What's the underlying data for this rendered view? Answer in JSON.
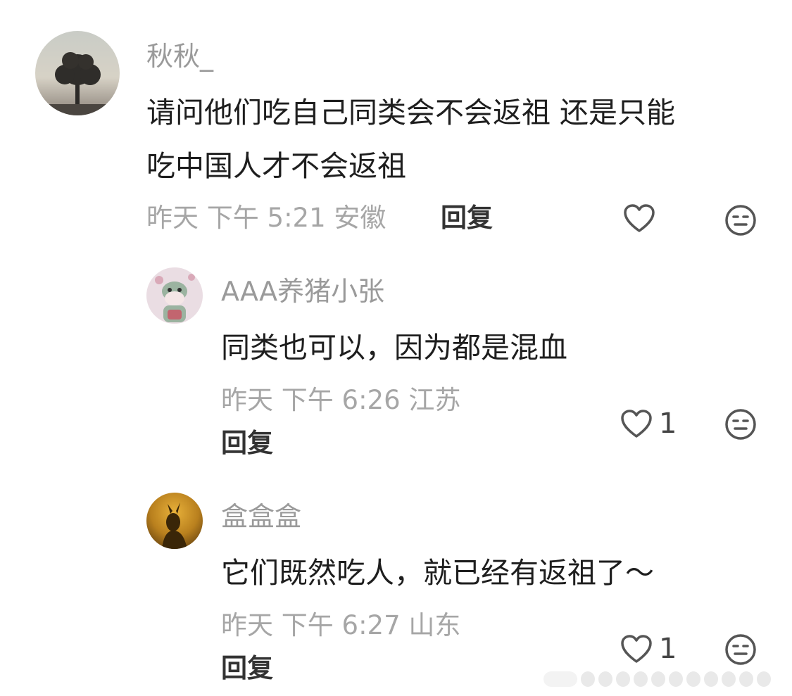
{
  "comments": [
    {
      "username": "秋秋_",
      "text_line1": "请问他们吃自己同类会不会返祖 还是只能",
      "text_line2": "吃中国人才不会返祖",
      "time": "昨天 下午 5:21 安徽",
      "reply_label": "回复",
      "likes": ""
    },
    {
      "username": "AAA养猪小张",
      "text": "同类也可以，因为都是混血",
      "time": "昨天 下午 6:26 江苏",
      "reply_label": "回复",
      "likes": "1"
    },
    {
      "username": "盒盒盒",
      "text": "它们既然吃人，就已经有返祖了～",
      "time": "昨天 下午 6:27 山东",
      "reply_label": "回复",
      "likes": "1"
    }
  ],
  "icons": {
    "like": "heart-outline-icon",
    "dislike": "neutral-face-icon"
  },
  "colors": {
    "username": "#9a9a9a",
    "meta": "#a6a6a6",
    "text": "#1e1e1e",
    "icon": "#555555"
  }
}
